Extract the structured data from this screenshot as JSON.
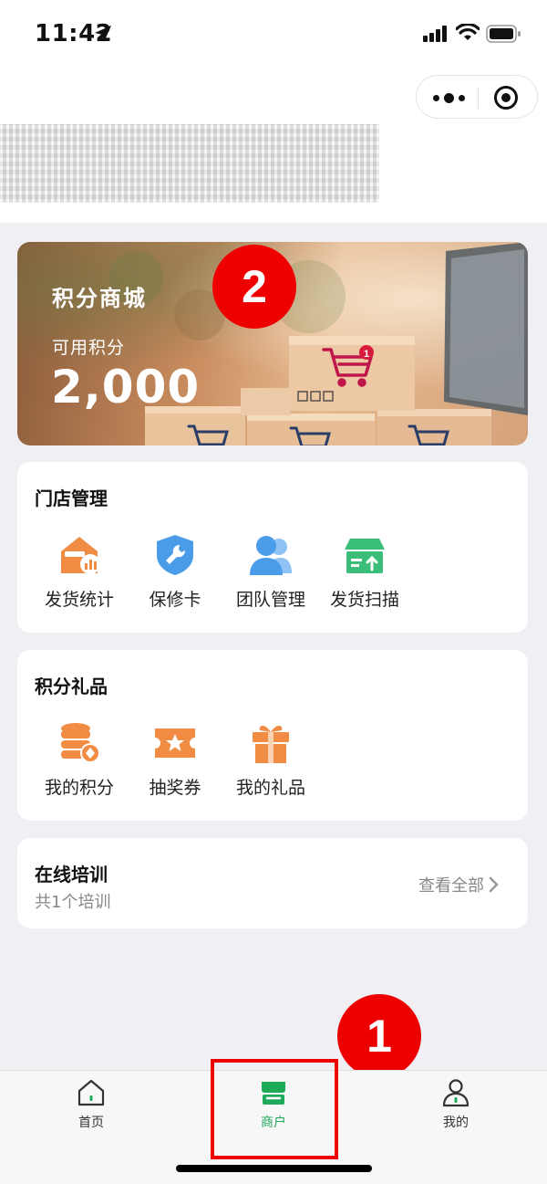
{
  "status_bar": {
    "time": "11:42"
  },
  "header": {
    "capsule_more": "more-icon",
    "capsule_close": "target-icon"
  },
  "banner": {
    "title": "积分商城",
    "points_label": "可用积分",
    "points_value": "2,000",
    "cart_badge": "1"
  },
  "store_management": {
    "title": "门店管理",
    "items": [
      {
        "label": "发货统计",
        "icon": "house-chart-icon",
        "color": "#f08c43"
      },
      {
        "label": "保修卡",
        "icon": "shield-wrench-icon",
        "color": "#4a9be8"
      },
      {
        "label": "团队管理",
        "icon": "team-icon",
        "color": "#4a9be8"
      },
      {
        "label": "发货扫描",
        "icon": "box-upload-icon",
        "color": "#3bbf78"
      }
    ]
  },
  "points_gifts": {
    "title": "积分礼品",
    "items": [
      {
        "label": "我的积分",
        "icon": "coins-icon",
        "color": "#f08c43"
      },
      {
        "label": "抽奖券",
        "icon": "ticket-icon",
        "color": "#f08c43"
      },
      {
        "label": "我的礼品",
        "icon": "gift-icon",
        "color": "#f08c43"
      }
    ]
  },
  "training": {
    "title": "在线培训",
    "subtitle": "共1个培训",
    "view_all": "查看全部"
  },
  "tabbar": {
    "tabs": [
      {
        "label": "首页",
        "icon": "home-icon"
      },
      {
        "label": "商户",
        "icon": "store-icon"
      },
      {
        "label": "我的",
        "icon": "profile-icon"
      }
    ],
    "active_index": 1,
    "accent_color": "#1faa59"
  },
  "annotations": {
    "marker_1": "1",
    "marker_2": "2",
    "marker_color": "#ee0000"
  }
}
